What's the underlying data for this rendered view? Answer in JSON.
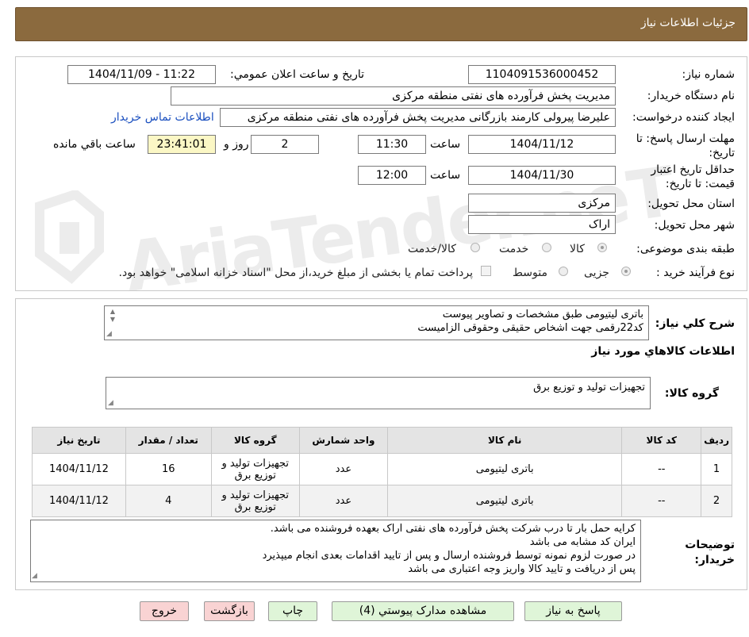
{
  "header": {
    "title": "جزئیات اطلاعات نیاز"
  },
  "watermark": {
    "text": "AriaTender.neT"
  },
  "form": {
    "need_number_label": "شماره نیاز:",
    "need_number": "1104091536000452",
    "announce_label": "تاریخ و ساعت اعلان عمومي:",
    "announce_value": "1404/11/09 - 11:22",
    "buyer_org_label": "نام دستگاه خریدار:",
    "buyer_org": "مدیریت پخش فرآورده های نفتی منطقه مرکزی",
    "creator_label": "ایجاد کننده درخواست:",
    "creator": "علیرضا پیرولی کارمند بازرگانی مدیریت پخش فرآورده های نفتی منطقه مرکزی",
    "contact_link": "اطلاعات تماس خریدار",
    "reply_deadline_label": "مهلت ارسال پاسخ: تا تاریخ:",
    "reply_date": "1404/11/12",
    "time_label": "ساعت",
    "reply_time": "11:30",
    "days": "2",
    "days_label": "روز و",
    "remaining_time": "23:41:01",
    "remaining_label": "ساعت باقي مانده",
    "validity_label": "حداقل تاریخ اعتبار قیمت: تا تاریخ:",
    "validity_date": "1404/11/30",
    "validity_time_label": "ساعت",
    "validity_time": "12:00",
    "province_label": "استان محل تحویل:",
    "province": "مرکزی",
    "city_label": "شهر محل تحویل:",
    "city": "اراک",
    "category_label": "طبقه بندی موضوعی:",
    "category_options": [
      "کالا",
      "خدمت",
      "کالا/خدمت"
    ],
    "process_label": "نوع فرآیند خرید :",
    "process_options": [
      "جزیی",
      "متوسط"
    ],
    "payment_note": "پرداخت تمام یا بخشی از مبلغ خرید،از محل \"اسناد خزانه اسلامی\" خواهد بود."
  },
  "summary": {
    "label": "شرح کلي نياز:",
    "line1": "باتری لیتیومی طبق مشخصات و تصاویر پیوست",
    "line2": "کد22رقمی  جهت اشخاص حقیقی وحقوقی الزامیست"
  },
  "goods": {
    "section_title": "اطلاعات کالاهاي مورد نياز",
    "group_label": "گروه کالا:",
    "group_value": "تجهیزات تولید و توزیع برق",
    "columns": [
      "ردیف",
      "کد کالا",
      "نام کالا",
      "واحد شمارش",
      "گروه کالا",
      "تعداد / مقدار",
      "تاریخ نیاز"
    ],
    "rows": [
      {
        "row": "1",
        "code": "--",
        "name": "باتری لیتیومی",
        "unit": "عدد",
        "group_l1": "تجهیزات تولید و",
        "group_l2": "توزیع برق",
        "qty": "16",
        "date": "1404/11/12"
      },
      {
        "row": "2",
        "code": "--",
        "name": "باتری لیتیومی",
        "unit": "عدد",
        "group_l1": "تجهیزات تولید و",
        "group_l2": "توزیع برق",
        "qty": "4",
        "date": "1404/11/12"
      }
    ]
  },
  "buyer_notes": {
    "label_l1": "توضیحات",
    "label_l2": "خریدار:",
    "lines": [
      "کرایه حمل بار تا درب شرکت  پخش فرآورده های نفتی اراک بعهده فروشنده می باشد.",
      "ایران کد مشابه می باشد",
      "در صورت لزوم نمونه توسط فروشنده ارسال و پس از تایید اقدامات بعدی انجام میپذیرد",
      "پس از دریافت و تایید کالا واریز وجه اعتباری می باشد"
    ]
  },
  "buttons": {
    "reply": "پاسخ به نیاز",
    "attachments": "مشاهده مدارک پیوستي (4)",
    "print": "چاپ",
    "back": "بازگشت",
    "exit": "خروج"
  },
  "colors": {
    "header": "#8b6a3e",
    "yellow": "#fbf7c5",
    "green_btn": "#dff5d8",
    "pink_btn": "#f9d3d3",
    "link": "#1a4fbf"
  }
}
